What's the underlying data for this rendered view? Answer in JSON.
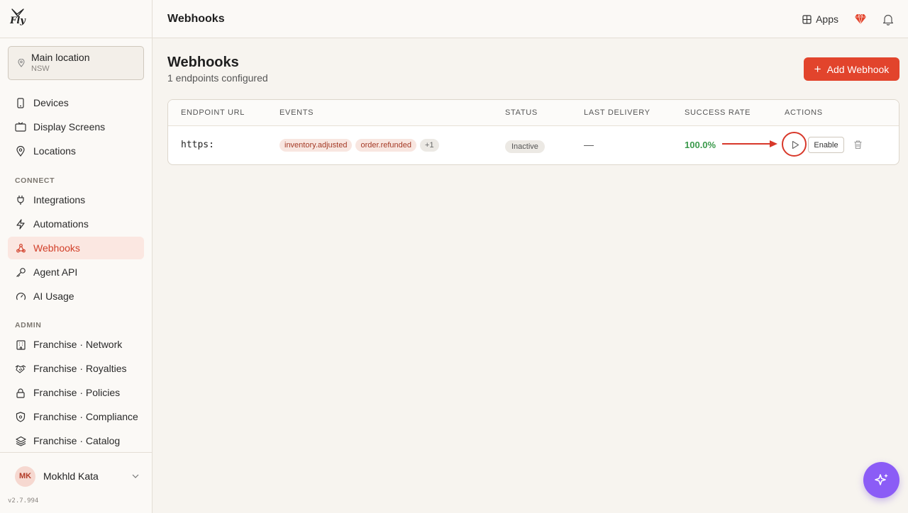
{
  "app": {
    "logo_text": "Fly",
    "version": "v2.7.994"
  },
  "location": {
    "name": "Main location",
    "region": "NSW"
  },
  "nav": {
    "main": [
      {
        "label": "Devices",
        "icon": "device-icon"
      },
      {
        "label": "Display Screens",
        "icon": "monitor-icon"
      },
      {
        "label": "Locations",
        "icon": "map-pin-icon"
      }
    ],
    "connect_label": "CONNECT",
    "connect": [
      {
        "label": "Integrations",
        "icon": "plug-icon"
      },
      {
        "label": "Automations",
        "icon": "zap-icon"
      },
      {
        "label": "Webhooks",
        "icon": "webhook-icon",
        "active": true
      },
      {
        "label": "Agent API",
        "icon": "key-icon"
      },
      {
        "label": "AI Usage",
        "icon": "gauge-icon"
      }
    ],
    "admin_label": "ADMIN",
    "admin": [
      {
        "label": "Franchise · Network",
        "icon": "building-icon"
      },
      {
        "label": "Franchise · Royalties",
        "icon": "handshake-icon"
      },
      {
        "label": "Franchise · Policies",
        "icon": "lock-icon"
      },
      {
        "label": "Franchise · Compliance",
        "icon": "shield-icon"
      },
      {
        "label": "Franchise · Catalog",
        "icon": "layers-icon"
      }
    ]
  },
  "user": {
    "initials": "MK",
    "name": "Mokhld Kata"
  },
  "topbar": {
    "title": "Webhooks",
    "apps_label": "Apps"
  },
  "page": {
    "title": "Webhooks",
    "subtitle": "1 endpoints configured",
    "add_button": "Add Webhook"
  },
  "table": {
    "headers": [
      "ENDPOINT URL",
      "EVENTS",
      "STATUS",
      "LAST DELIVERY",
      "SUCCESS RATE",
      "ACTIONS"
    ],
    "rows": [
      {
        "url": "https:",
        "events": [
          "inventory.adjusted",
          "order.refunded"
        ],
        "more_events": "+1",
        "status": "Inactive",
        "last_delivery": "—",
        "success_rate": "100.0%",
        "enable_label": "Enable"
      }
    ]
  },
  "colors": {
    "accent": "#e2442c",
    "active_bg": "#fbe7e1",
    "success": "#3b9a4c",
    "fab": "#8b5cf6"
  }
}
